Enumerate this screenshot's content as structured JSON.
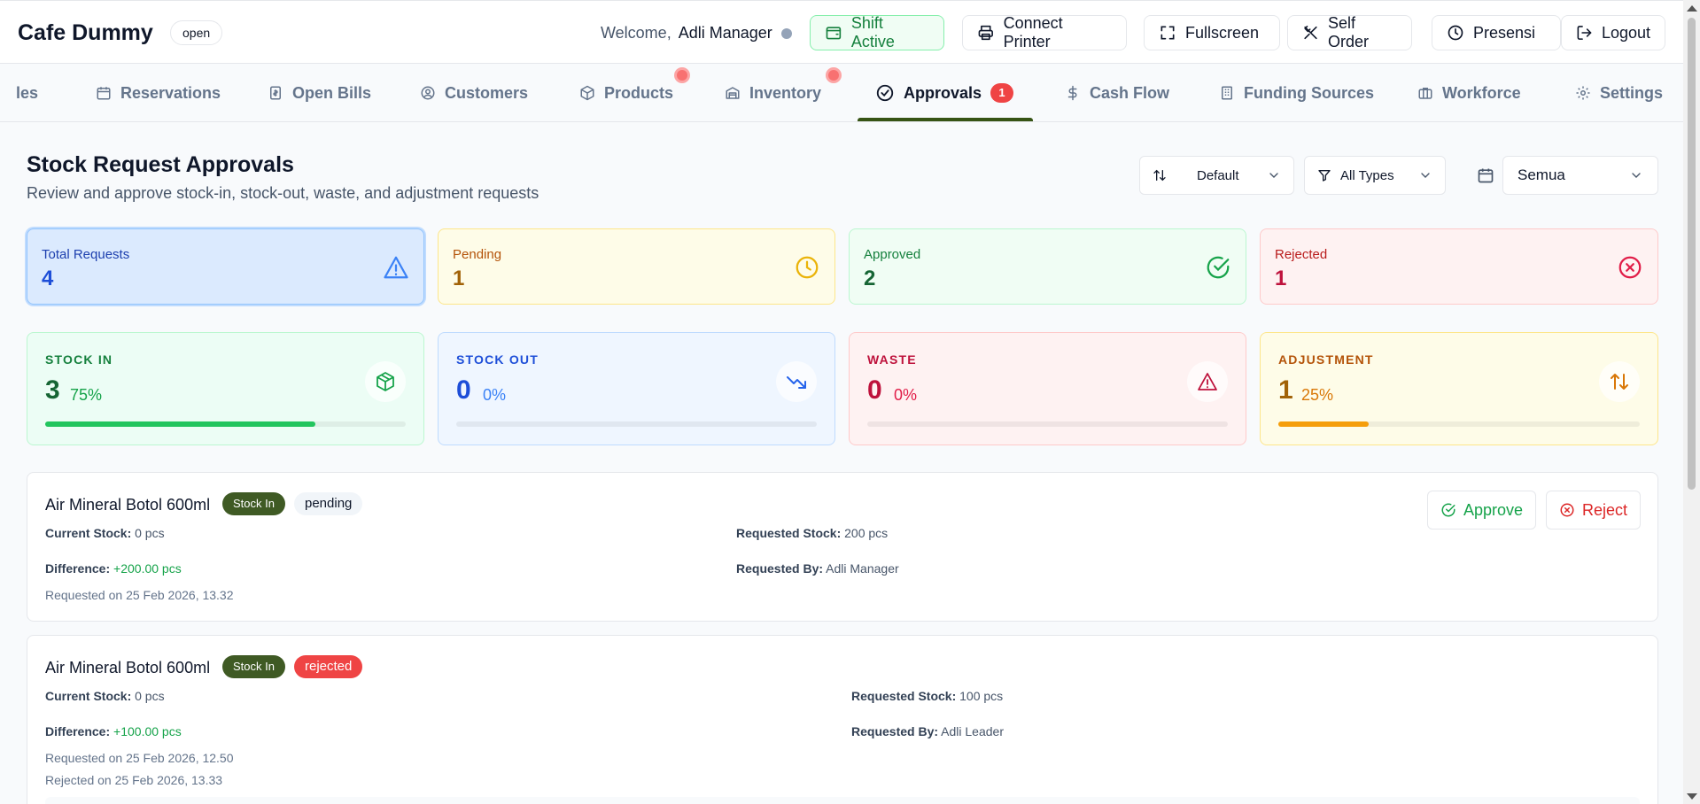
{
  "header": {
    "brand": "Cafe Dummy",
    "status_badge": "open",
    "welcome_label": "Welcome,",
    "user_name": "Adli Manager",
    "buttons": {
      "shift": "Shift Active",
      "printer": "Connect Printer",
      "fullscreen": "Fullscreen",
      "self_order": "Self Order",
      "presensi": "Presensi",
      "logout": "Logout"
    }
  },
  "tabs": [
    {
      "label": "les"
    },
    {
      "label": "Reservations"
    },
    {
      "label": "Open Bills"
    },
    {
      "label": "Customers"
    },
    {
      "label": "Products"
    },
    {
      "label": "Inventory"
    },
    {
      "label": "Approvals",
      "badge": "1"
    },
    {
      "label": "Cash Flow"
    },
    {
      "label": "Funding Sources"
    },
    {
      "label": "Workforce"
    },
    {
      "label": "Settings"
    }
  ],
  "page": {
    "title": "Stock Request Approvals",
    "subtitle": "Review and approve stock-in, stock-out, waste, and adjustment requests",
    "sort_value": "Default",
    "type_filter": "All Types",
    "date_filter": "Semua"
  },
  "stats": [
    {
      "label": "Total Requests",
      "value": "4"
    },
    {
      "label": "Pending",
      "value": "1"
    },
    {
      "label": "Approved",
      "value": "2"
    },
    {
      "label": "Rejected",
      "value": "1"
    }
  ],
  "types": [
    {
      "label": "STOCK IN",
      "value": "3",
      "percent": "75%",
      "fraction": 0.75
    },
    {
      "label": "STOCK OUT",
      "value": "0",
      "percent": "0%",
      "fraction": 0
    },
    {
      "label": "WASTE",
      "value": "0",
      "percent": "0%",
      "fraction": 0
    },
    {
      "label": "ADJUSTMENT",
      "value": "1",
      "percent": "25%",
      "fraction": 0.25
    }
  ],
  "labels": {
    "current_stock": "Current Stock:",
    "requested_stock": "Requested Stock:",
    "difference": "Difference:",
    "requested_by": "Requested By:",
    "approve": "Approve",
    "reject": "Reject"
  },
  "requests": [
    {
      "product": "Air Mineral Botol 600ml",
      "type": "Stock In",
      "status": "pending",
      "current_stock": "0 pcs",
      "requested_stock": "200 pcs",
      "difference": "+200.00 pcs",
      "requested_by": "Adli Manager",
      "requested_on": "Requested on 25 Feb 2026, 13.32"
    },
    {
      "product": "Air Mineral Botol 600ml",
      "type": "Stock In",
      "status": "rejected",
      "current_stock": "0 pcs",
      "requested_stock": "100 pcs",
      "difference": "+100.00 pcs",
      "requested_by": "Adli Leader",
      "requested_on": "Requested on 25 Feb 2026, 12.50",
      "rejected_on": "Rejected on 25 Feb 2026, 13.33"
    }
  ],
  "colors": {
    "accent": "#365314",
    "danger": "#ef4444",
    "success": "#16a34a"
  }
}
